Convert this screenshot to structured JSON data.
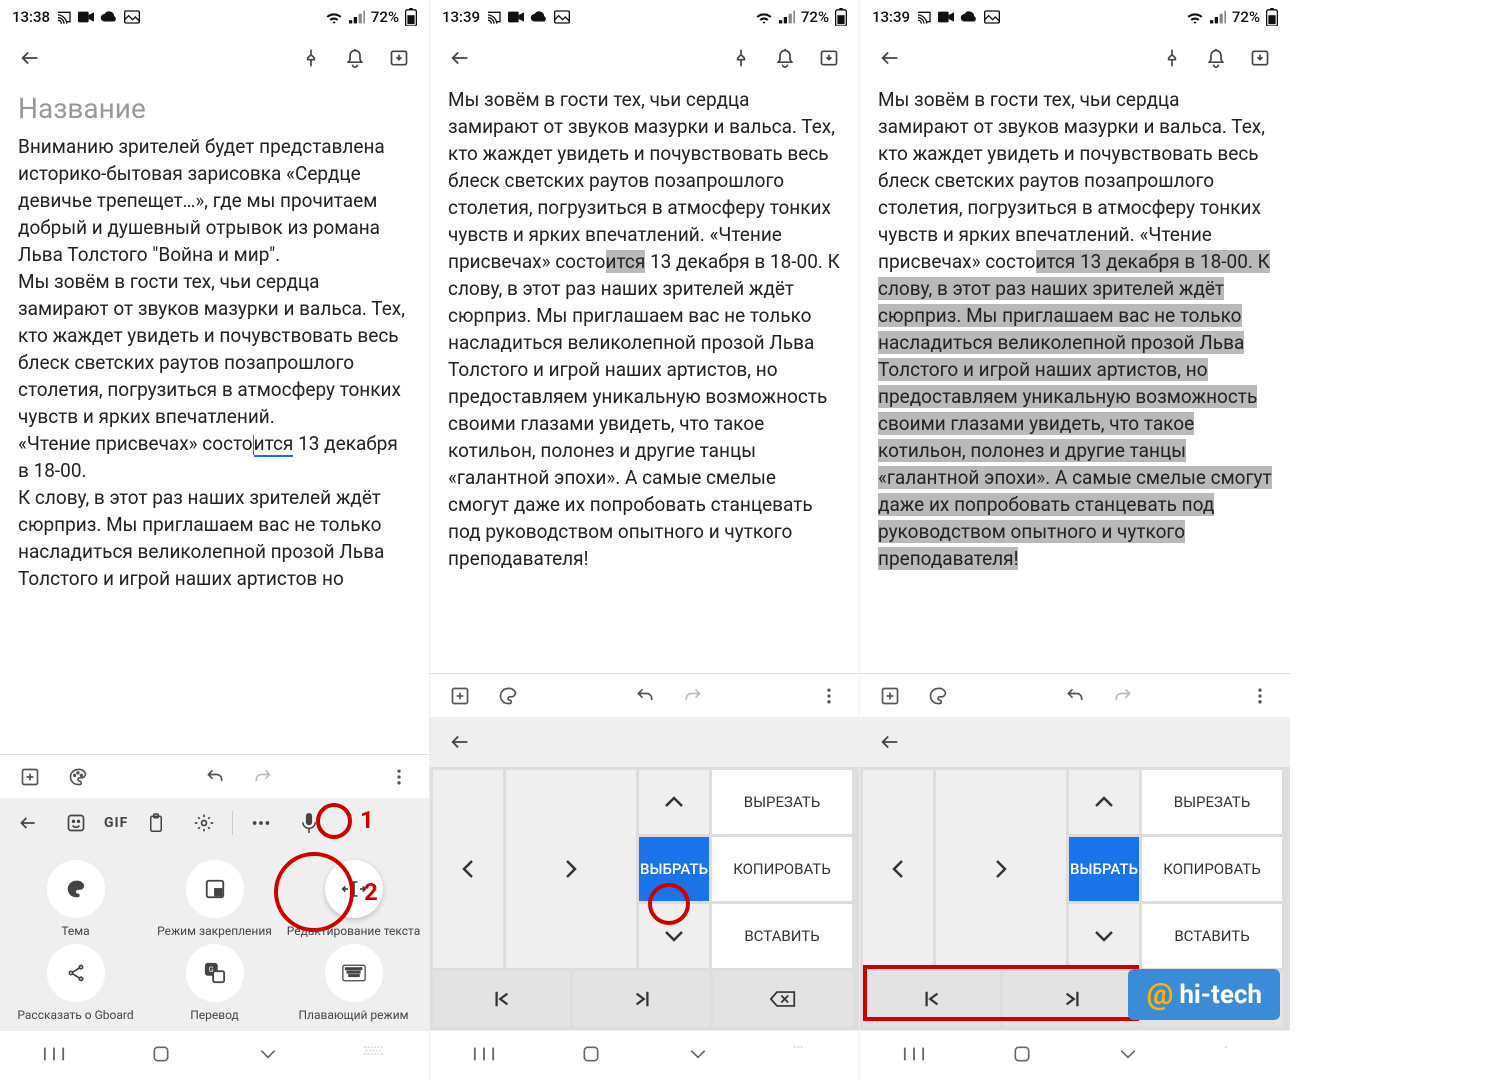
{
  "status": {
    "t1": "13:38",
    "t2": "13:39",
    "t3": "13:39",
    "batt": "72%"
  },
  "editor": {
    "title_ph": "Название",
    "p1_body": "Вниманию зрителей будет представлена историко-бытовая зарисовка «Сердце девичье трепещет…», где мы прочитаем добрый и душевный отрывок из романа Льва Толстого \"Война и мир\".\nМы зовём в гости тех, чьи сердца замирают от звуков мазурки и вальса. Тех, кто жаждет увидеть и почувствовать весь блеск светских раутов позапрошлого столетия, погрузиться в атмосферу тонких чувств и ярких впечатлений.\n«Чтение присвечах» состоится 13 декабря в 18-00.\nК слову, в этот раз наших зрителей ждёт сюрприз. Мы приглашаем вас не только насладиться великолепной прозой Льва Толстого и игрой наших артистов, но",
    "p23_pre": "Мы зовём в гости тех, чьи сердца замирают от звуков мазурки и вальса. Тех, кто жаждет увидеть и почувствовать весь блеск светских раутов позапрошлого столетия, погрузиться в атмосферу тонких чувств и ярких впечатлений.\n«Чтение присвечах» состо",
    "p2_sel": "ится",
    "p2_post": " 13 декабря в 18-00.\nК слову, в этот раз наших зрителей ждёт сюрприз. Мы приглашаем вас не только насладиться великолепной прозой Льва Толстого и игрой наших артистов, но предоставляем уникальную возможность своими глазами увидеть, что такое котильон, полонез и другие танцы «галантной эпохи». А самые смелые смогут даже их попробовать станцевать под руководством опытного и чуткого преподавателя!",
    "p3_sel": "ится 13 декабря в 18-00.\nК слову, в этот раз наших зрителей ждёт сюрприз. Мы приглашаем вас не только насладиться великолепной прозой Льва Толстого и игрой наших артистов, но предоставляем уникальную возможность своими глазами увидеть, что такое котильон, полонез и другие танцы «галантной эпохи». А самые смелые смогут даже их попробовать станцевать под руководством опытного и чуткого преподавателя!"
  },
  "kbd_menu": {
    "gif": "GIF",
    "items": [
      "Тема",
      "Режим закрепления",
      "Редактирование текста",
      "Рассказать о Gboard",
      "Перевод",
      "Плавающий режим"
    ]
  },
  "pad": {
    "select": "ВЫБРАТЬ",
    "cut": "ВЫРЕЗАТЬ",
    "copy": "КОПИРОВАТЬ",
    "paste": "ВСТАВИТЬ"
  },
  "annot": {
    "n1": "1",
    "n2": "2"
  },
  "watermark": "hi-tech"
}
